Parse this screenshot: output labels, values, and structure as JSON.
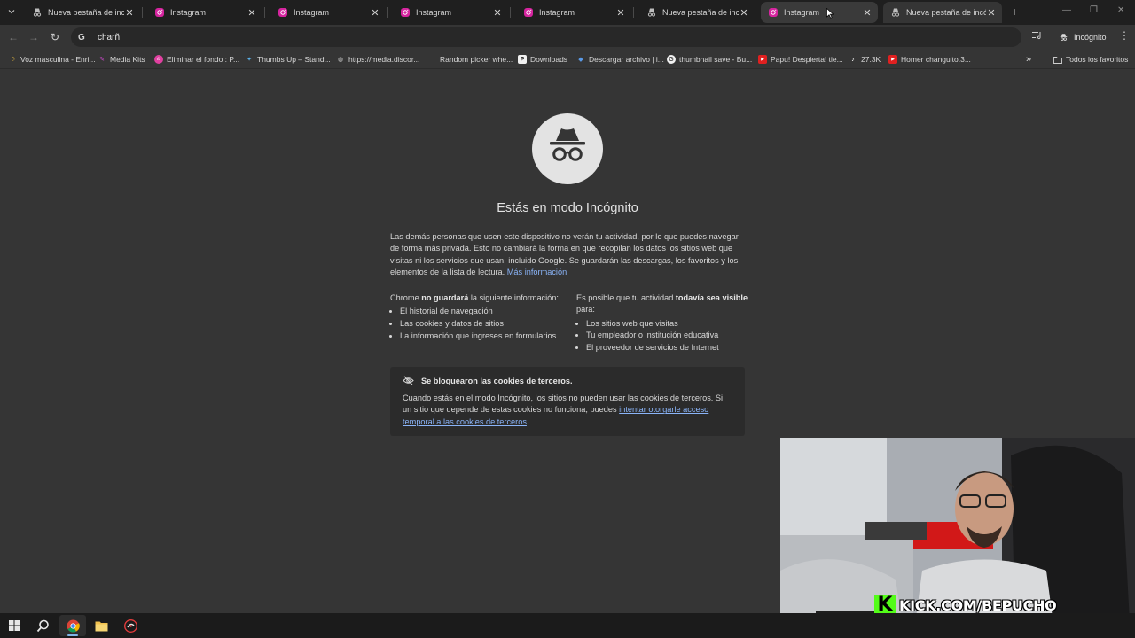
{
  "tabs": [
    {
      "title": "Nueva pestaña de incógnito",
      "favicon": "incognito-icon",
      "state": "normal"
    },
    {
      "title": "Instagram",
      "favicon": "instagram-icon",
      "state": "normal"
    },
    {
      "title": "Instagram",
      "favicon": "instagram-icon",
      "state": "normal"
    },
    {
      "title": "Instagram",
      "favicon": "instagram-icon",
      "state": "normal"
    },
    {
      "title": "Instagram",
      "favicon": "instagram-icon",
      "state": "normal"
    },
    {
      "title": "Nueva pestaña de incógnito",
      "favicon": "incognito-icon",
      "state": "normal"
    },
    {
      "title": "Instagram",
      "favicon": "instagram-icon",
      "state": "hovered"
    },
    {
      "title": "Nueva pestaña de incógnito",
      "favicon": "incognito-icon",
      "state": "active"
    }
  ],
  "toolbar": {
    "omnibox_value": "charñ",
    "profile_label": "Incógnito"
  },
  "bookmarks": [
    {
      "label": "Voz masculina - Enri...",
      "icon": "moon-icon"
    },
    {
      "label": "Media Kits",
      "icon": "media-kits-icon"
    },
    {
      "label": "Eliminar el fondo : P...",
      "icon": "remove-bg-icon"
    },
    {
      "label": "Thumbs Up – Stand...",
      "icon": "star-icon"
    },
    {
      "label": "https://media.discor...",
      "icon": "globe-icon"
    },
    {
      "label": "Random picker whe...",
      "icon": "wheel-icon"
    },
    {
      "label": "Downloads",
      "icon": "downloads-icon"
    },
    {
      "label": "Descargar archivo | i...",
      "icon": "download-icon"
    },
    {
      "label": "thumbnail save - Bu...",
      "icon": "google-icon"
    },
    {
      "label": "Papu! Despierta! tie...",
      "icon": "youtube-icon"
    },
    {
      "label": "27.3K",
      "icon": "tiktok-icon"
    },
    {
      "label": "Homer changuito.3...",
      "icon": "youtube-icon"
    }
  ],
  "bookmarks_more": "»",
  "all_bookmarks_label": "Todos los favoritos",
  "page": {
    "heading": "Estás en modo Incógnito",
    "intro": "Las demás personas que usen este dispositivo no verán tu actividad, por lo que puedes navegar de forma más privada. Esto no cambiará la forma en que recopilan los datos los sitios web que visitas ni los servicios que usan, incluido Google. Se guardarán las descargas, los favoritos y los elementos de la lista de lectura.",
    "more_info_link": "Más información",
    "left_col": {
      "prefix": "Chrome ",
      "bold": "no guardará",
      "suffix": " la siguiente información:",
      "items": [
        "El historial de navegación",
        "Las cookies y datos de sitios",
        "La información que ingreses en formularios"
      ]
    },
    "right_col": {
      "prefix": "Es posible que tu actividad ",
      "bold": "todavía sea visible",
      "suffix": " para:",
      "items": [
        "Los sitios web que visitas",
        "Tu empleador o institución educativa",
        "El proveedor de servicios de Internet"
      ]
    },
    "cookie_box": {
      "title": "Se bloquearon las cookies de terceros.",
      "text": "Cuando estás en el modo Incógnito, los sitios no pueden usar las cookies de terceros. Si un sitio que depende de estas cookies no funciona, puedes ",
      "link": "intentar otorgarle acceso temporal a las cookies de terceros",
      "end": "."
    }
  },
  "overlay": {
    "kick_letter": "K",
    "kick_url": "KICK.COM/BEPUCHO"
  },
  "taskbar": [
    "windows-start-icon",
    "search-icon",
    "chrome-icon",
    "file-explorer-icon",
    "app-icon"
  ],
  "colors": {
    "page_bg": "#353535",
    "tabstrip_bg": "#1f1f1f",
    "link": "#8ab4f8",
    "kick_green": "#53fc18"
  }
}
